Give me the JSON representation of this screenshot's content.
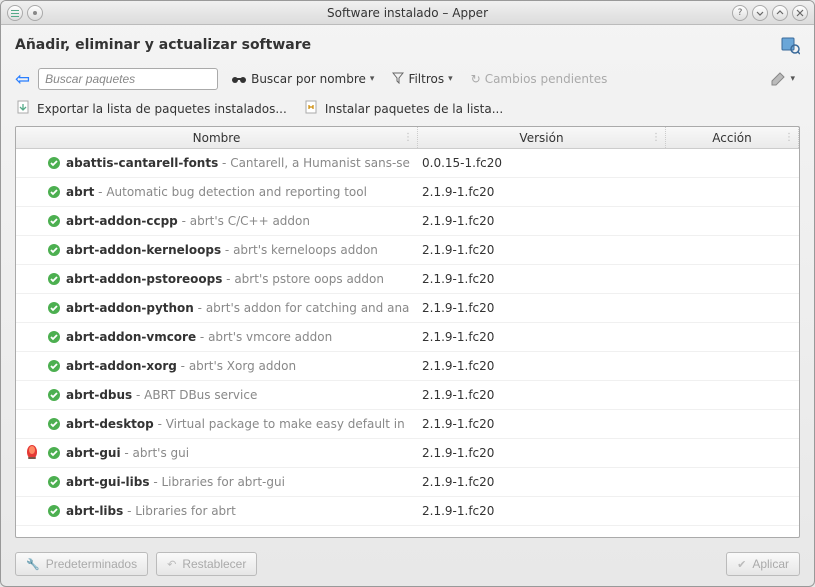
{
  "window": {
    "title": "Software instalado – Apper"
  },
  "header": {
    "title": "Añadir, eliminar y actualizar software"
  },
  "toolbar": {
    "search_placeholder": "Buscar paquetes",
    "search_by": "Buscar por nombre",
    "filters": "Filtros",
    "pending": "Cambios pendientes"
  },
  "subtoolbar": {
    "export": "Exportar la lista de paquetes instalados...",
    "install": "Instalar paquetes de la lista..."
  },
  "columns": {
    "name": "Nombre",
    "version": "Versión",
    "action": "Acción"
  },
  "packages": [
    {
      "name": "abattis-cantarell-fonts",
      "desc": "Cantarell, a Humanist sans-se",
      "version": "0.0.15-1.fc20",
      "alert": false
    },
    {
      "name": "abrt",
      "desc": "Automatic bug detection and reporting tool",
      "version": "2.1.9-1.fc20",
      "alert": false
    },
    {
      "name": "abrt-addon-ccpp",
      "desc": "abrt's C/C++ addon",
      "version": "2.1.9-1.fc20",
      "alert": false
    },
    {
      "name": "abrt-addon-kerneloops",
      "desc": "abrt's kerneloops addon",
      "version": "2.1.9-1.fc20",
      "alert": false
    },
    {
      "name": "abrt-addon-pstoreoops",
      "desc": "abrt's pstore oops addon",
      "version": "2.1.9-1.fc20",
      "alert": false
    },
    {
      "name": "abrt-addon-python",
      "desc": "abrt's addon for catching and ana",
      "version": "2.1.9-1.fc20",
      "alert": false
    },
    {
      "name": "abrt-addon-vmcore",
      "desc": "abrt's vmcore addon",
      "version": "2.1.9-1.fc20",
      "alert": false
    },
    {
      "name": "abrt-addon-xorg",
      "desc": "abrt's Xorg addon",
      "version": "2.1.9-1.fc20",
      "alert": false
    },
    {
      "name": "abrt-dbus",
      "desc": "ABRT DBus service",
      "version": "2.1.9-1.fc20",
      "alert": false
    },
    {
      "name": "abrt-desktop",
      "desc": "Virtual package to make easy default in",
      "version": "2.1.9-1.fc20",
      "alert": false
    },
    {
      "name": "abrt-gui",
      "desc": "abrt's gui",
      "version": "2.1.9-1.fc20",
      "alert": true
    },
    {
      "name": "abrt-gui-libs",
      "desc": "Libraries for abrt-gui",
      "version": "2.1.9-1.fc20",
      "alert": false
    },
    {
      "name": "abrt-libs",
      "desc": "Libraries for abrt",
      "version": "2.1.9-1.fc20",
      "alert": false
    }
  ],
  "footer": {
    "defaults": "Predeterminados",
    "reset": "Restablecer",
    "apply": "Aplicar"
  }
}
